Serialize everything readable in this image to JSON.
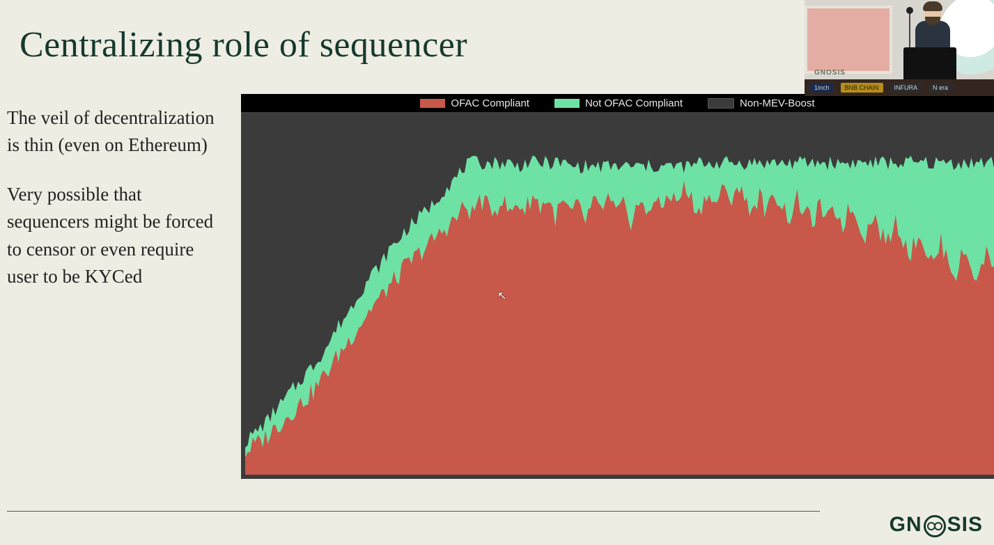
{
  "title": "Centralizing role of sequencer",
  "paragraphs": [
    "The veil of decentralization is thin (even on Ethereum)",
    "Very possible that sequencers might be forced to censor or even require user to be KYCed"
  ],
  "logo_text": {
    "a": "GN",
    "b": "SIS"
  },
  "inset": {
    "gnosis_small": "GNOSIS",
    "sponsors": [
      "1inch",
      "BNB CHAIN",
      "INFURA",
      "N era"
    ]
  },
  "chart_data": {
    "type": "area",
    "title": "",
    "xlabel": "",
    "ylabel": "",
    "ylim": [
      0,
      100
    ],
    "stacking": "percent",
    "note": "Stacked percentage area. Values are approximate percentages read from the plot; bottom series is OFAC Compliant (red), middle is Not OFAC Compliant (green), remainder to 100 is Non-MEV-Boost (dark grey).",
    "legend": [
      {
        "name": "OFAC Compliant",
        "color": "#c7584a"
      },
      {
        "name": "Not OFAC Compliant",
        "color": "#6ee2a5"
      },
      {
        "name": "Non-MEV-Boost",
        "color": "#3b3b3b"
      }
    ],
    "x": [
      0,
      1,
      2,
      3,
      4,
      5,
      6,
      7,
      8,
      9,
      10,
      11,
      12,
      13,
      14,
      15,
      16,
      17,
      18,
      19,
      20,
      21,
      22,
      23,
      24,
      25,
      26,
      27,
      28,
      29,
      30,
      31,
      32,
      33,
      34,
      35,
      36,
      37,
      38,
      39,
      40,
      41,
      42,
      43,
      44,
      45,
      46,
      47,
      48,
      49,
      50,
      51,
      52,
      53,
      54,
      55,
      56,
      57,
      58,
      59,
      60,
      61,
      62,
      63,
      64,
      65,
      66,
      67,
      68,
      69,
      70,
      71,
      72,
      73,
      74,
      75,
      76,
      77,
      78,
      79,
      80,
      81,
      82,
      83,
      84,
      85,
      86,
      87,
      88,
      89,
      90,
      91,
      92,
      93,
      94,
      95,
      96,
      97,
      98,
      99
    ],
    "series": [
      {
        "name": "OFAC Compliant",
        "color": "#c7584a",
        "values": [
          6,
          8,
          9,
          11,
          13,
          15,
          17,
          19,
          21,
          23,
          26,
          29,
          32,
          35,
          38,
          41,
          44,
          47,
          49,
          52,
          54,
          57,
          59,
          61,
          63,
          65,
          67,
          69,
          71,
          74,
          72,
          76,
          74,
          73,
          76,
          72,
          75,
          73,
          77,
          74,
          76,
          71,
          75,
          72,
          74,
          70,
          75,
          73,
          76,
          72,
          74,
          70,
          75,
          72,
          76,
          73,
          78,
          75,
          79,
          76,
          72,
          78,
          74,
          79,
          75,
          80,
          76,
          73,
          77,
          72,
          78,
          74,
          71,
          76,
          72,
          70,
          74,
          70,
          73,
          69,
          74,
          70,
          66,
          72,
          67,
          64,
          70,
          65,
          61,
          67,
          62,
          58,
          64,
          59,
          55,
          62,
          57,
          54,
          62,
          58
        ]
      },
      {
        "name": "Not OFAC Compliant",
        "color": "#6ee2a5",
        "values": [
          3,
          3,
          4,
          4,
          5,
          5,
          6,
          6,
          7,
          7,
          7,
          7,
          8,
          8,
          8,
          9,
          9,
          9,
          9,
          10,
          10,
          10,
          10,
          10,
          10,
          10,
          11,
          11,
          11,
          11,
          14,
          10,
          12,
          13,
          10,
          14,
          10,
          13,
          9,
          12,
          10,
          15,
          11,
          13,
          11,
          15,
          10,
          12,
          9,
          13,
          11,
          15,
          10,
          13,
          9,
          12,
          7,
          10,
          6,
          9,
          14,
          8,
          12,
          7,
          11,
          6,
          10,
          13,
          9,
          14,
          8,
          12,
          15,
          10,
          14,
          16,
          12,
          16,
          13,
          17,
          12,
          16,
          20,
          14,
          19,
          22,
          16,
          21,
          25,
          19,
          24,
          28,
          22,
          27,
          31,
          24,
          29,
          32,
          24,
          28
        ]
      },
      {
        "name": "Non-MEV-Boost",
        "color": "#3b3b3b",
        "values": [
          91,
          89,
          87,
          85,
          82,
          80,
          77,
          75,
          72,
          70,
          67,
          64,
          60,
          57,
          54,
          50,
          47,
          44,
          42,
          38,
          36,
          33,
          31,
          29,
          27,
          25,
          22,
          20,
          18,
          15,
          14,
          14,
          14,
          14,
          14,
          14,
          15,
          14,
          14,
          14,
          14,
          14,
          14,
          15,
          15,
          15,
          15,
          15,
          15,
          15,
          15,
          15,
          15,
          15,
          15,
          15,
          15,
          15,
          15,
          15,
          14,
          14,
          14,
          14,
          14,
          14,
          14,
          14,
          14,
          14,
          14,
          14,
          14,
          14,
          14,
          14,
          14,
          14,
          14,
          14,
          14,
          14,
          14,
          14,
          14,
          14,
          14,
          14,
          14,
          14,
          14,
          14,
          14,
          14,
          14,
          14,
          14,
          14,
          14,
          14
        ]
      }
    ]
  }
}
